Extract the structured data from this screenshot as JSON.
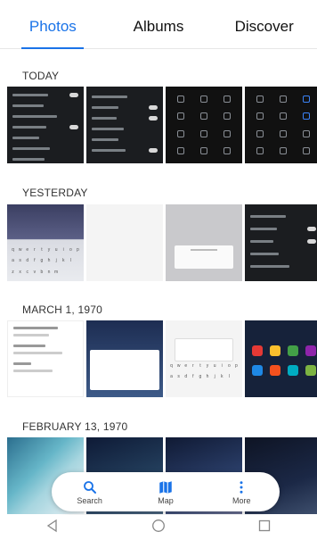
{
  "tabs": [
    {
      "label": "Photos",
      "active": true
    },
    {
      "label": "Albums",
      "active": false
    },
    {
      "label": "Discover",
      "active": false
    }
  ],
  "sections": [
    {
      "title": "TODAY"
    },
    {
      "title": "YESTERDAY"
    },
    {
      "title": "MARCH 1, 1970"
    },
    {
      "title": "FEBRUARY 13, 1970"
    }
  ],
  "bottom_actions": [
    {
      "label": "Search",
      "icon": "search-icon"
    },
    {
      "label": "Map",
      "icon": "map-icon"
    },
    {
      "label": "More",
      "icon": "more-vert-icon"
    }
  ],
  "navbar": [
    {
      "icon": "back-triangle-icon"
    },
    {
      "icon": "home-circle-icon"
    },
    {
      "icon": "recents-square-icon"
    }
  ],
  "colors": {
    "accent": "#1a73e8"
  }
}
